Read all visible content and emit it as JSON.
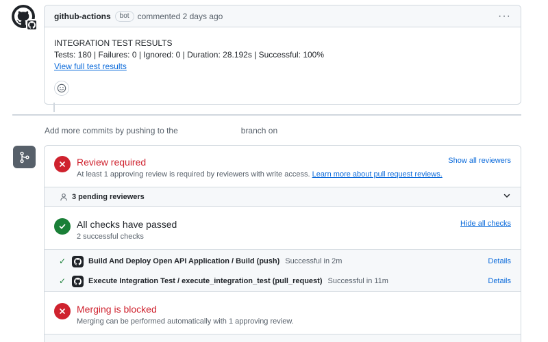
{
  "comment": {
    "author": "github-actions",
    "badge": "bot",
    "meta": "commented 2 days ago",
    "menu_icon": "kebab-horizontal-icon",
    "heading": "INTEGRATION TEST RESULTS",
    "summary": "Tests: 180 | Failures: 0 | Ignored: 0 | Duration: 28.192s | Successful: 100%",
    "link": "View full test results",
    "reaction_icon": "smiley-icon"
  },
  "hint": {
    "prefix": "Add more commits by pushing to the",
    "suffix": "branch on"
  },
  "merge": {
    "review": {
      "title": "Review required",
      "description": "At least 1 approving review is required by reviewers with write access.",
      "learn_more": "Learn more about pull request reviews.",
      "action": "Show all reviewers"
    },
    "pending": {
      "label": "3 pending reviewers"
    },
    "checks": {
      "title": "All checks have passed",
      "subtitle": "2 successful checks",
      "action": "Hide all checks",
      "items": [
        {
          "name": "Build And Deploy Open API Application / Build (push)",
          "status": "Successful in 2m",
          "details": "Details"
        },
        {
          "name": "Execute Integration Test / execute_integration_test (pull_request)",
          "status": "Successful in 11m",
          "details": "Details"
        }
      ]
    },
    "blocked": {
      "title": "Merging is blocked",
      "description": "Merging can be performed automatically with 1 approving review."
    }
  },
  "colors": {
    "danger": "#cf222e",
    "success": "#1a7f37",
    "link": "#0969da",
    "muted": "#57606a"
  }
}
